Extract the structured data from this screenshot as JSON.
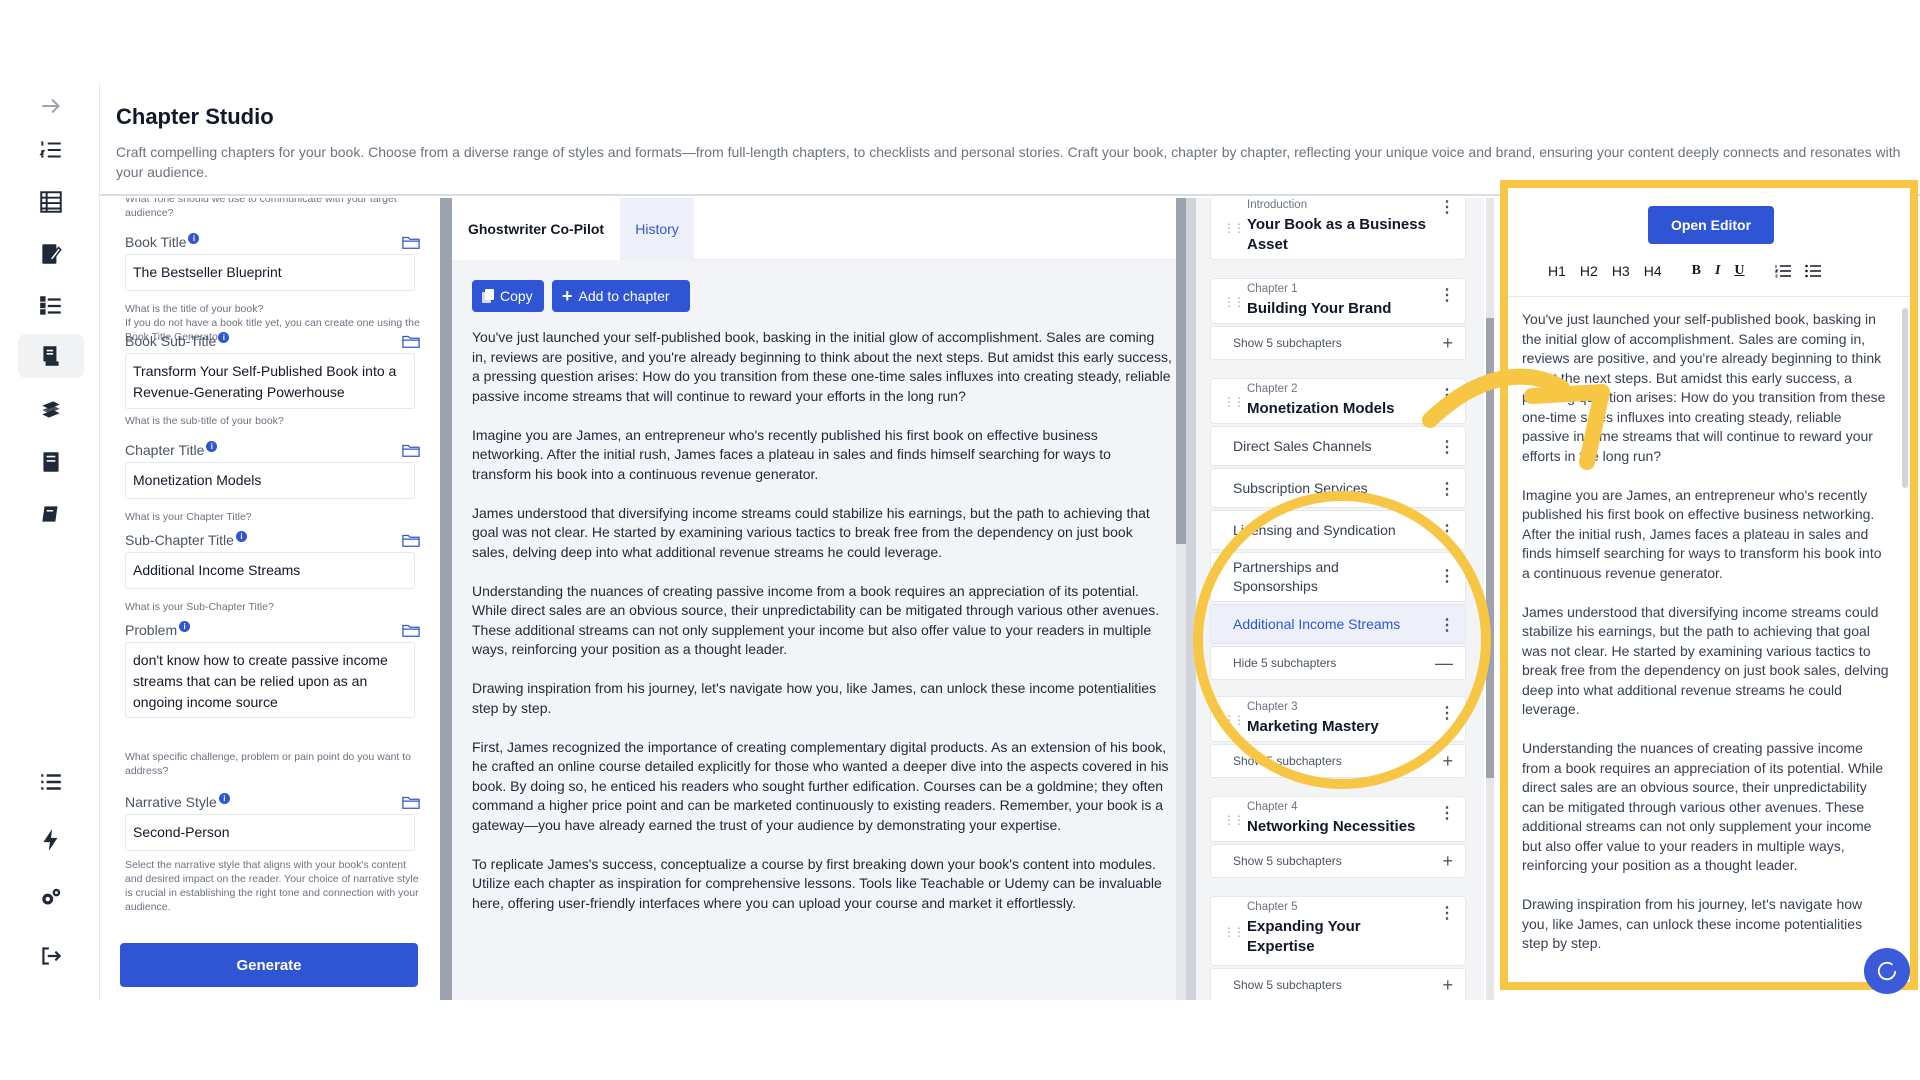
{
  "header": {
    "title": "Chapter Studio",
    "description": "Craft compelling chapters for your book. Choose from a diverse range of styles and formats—from full-length chapters, to checklists and personal stories. Craft your book, chapter by chapter, reflecting your unique voice and brand, ensuring your content deeply connects and resonates with your audience."
  },
  "form": {
    "tone_help_cut": "What Tone should we use to communicate with your target audience?",
    "fields": [
      {
        "label": "Book Title",
        "value": "The Bestseller Blueprint",
        "help": "What is the title of your book?\nIf you do not have a book title yet, you can create one using the Book Title Generator."
      },
      {
        "label": "Book Sub-Title",
        "value": "Transform Your Self-Published Book into a Revenue-Generating Powerhouse",
        "help": "What is the sub-title of your book?"
      },
      {
        "label": "Chapter Title",
        "value": "Monetization Models",
        "help": "What is your Chapter Title?"
      },
      {
        "label": "Sub-Chapter Title",
        "value": "Additional Income Streams",
        "help": "What is your Sub-Chapter Title?"
      },
      {
        "label": "Problem",
        "value": "don't know how to create passive income streams that can be relied upon as an ongoing income source",
        "help": "What specific challenge, problem or pain point do you want to address?"
      },
      {
        "label": "Narrative Style",
        "value": "Second-Person",
        "help": "Select the narrative style that aligns with your book's content and desired impact on the reader. Your choice of narrative style is crucial in establishing the right tone and connection with your audience."
      }
    ],
    "generate_label": "Generate"
  },
  "copilot": {
    "tab_ghost": "Ghostwriter Co-Pilot",
    "tab_history": "History",
    "copy_label": "Copy",
    "add_label": "Add to chapter",
    "paragraphs": [
      "You've just launched your self-published book, basking in the initial glow of accomplishment. Sales are coming in, reviews are positive, and you're already beginning to think about the next steps. But amidst this early success, a pressing question arises: How do you transition from these one-time sales influxes into creating steady, reliable passive income streams that will continue to reward your efforts in the long run?",
      "Imagine you are James, an entrepreneur who's recently published his first book on effective business networking. After the initial rush, James faces a plateau in sales and finds himself searching for ways to transform his book into a continuous revenue generator.",
      "James understood that diversifying income streams could stabilize his earnings, but the path to achieving that goal was not clear. He started by examining various tactics to break free from the dependency on just book sales, delving deep into what additional revenue streams he could leverage.",
      "Understanding the nuances of creating passive income from a book requires an appreciation of its potential. While direct sales are an obvious source, their unpredictability can be mitigated through various other avenues. These additional streams can not only supplement your income but also offer value to your readers in multiple ways, reinforcing your position as a thought leader.",
      "Drawing inspiration from his journey, let's navigate how you, like James, can unlock these income potentialities step by step.",
      "First, James recognized the importance of creating complementary digital products. As an extension of his book, he crafted an online course detailed explicitly for those who wanted a deeper dive into the aspects covered in his book. By doing so, he enticed his readers who sought further edification. Courses can be a goldmine; they often command a higher price point and can be marketed continuously to existing readers. Remember, your book is a gateway—you have already earned the trust of your audience by demonstrating your expertise.",
      "To replicate James's success, conceptualize a course by first breaking down your book's content into modules. Utilize each chapter as inspiration for comprehensive lessons. Tools like Teachable or Udemy can be invaluable here, offering user-friendly interfaces where you can upload your course and market it effortlessly."
    ]
  },
  "outline": {
    "intro": {
      "kicker": "Introduction",
      "title": "Your Book as a Business Asset"
    },
    "ch1": {
      "kicker": "Chapter 1",
      "title": "Building Your Brand",
      "toggle": "Show 5 subchapters"
    },
    "ch2": {
      "kicker": "Chapter 2",
      "title": "Monetization Models",
      "toggle": "Hide 5 subchapters",
      "subs": [
        "Direct Sales Channels",
        "Subscription Services",
        "Licensing and Syndication",
        "Partnerships and Sponsorships",
        "Additional Income Streams"
      ]
    },
    "ch3": {
      "kicker": "Chapter 3",
      "title": "Marketing Mastery",
      "toggle": "Show 5 subchapters"
    },
    "ch4": {
      "kicker": "Chapter 4",
      "title": "Networking Necessities",
      "toggle": "Show 5 subchapters"
    },
    "ch5": {
      "kicker": "Chapter 5",
      "title": "Expanding Your Expertise",
      "toggle": "Show 5 subchapters"
    }
  },
  "editor": {
    "open_label": "Open Editor",
    "toolbar": [
      "H1",
      "H2",
      "H3",
      "H4",
      "B",
      "I",
      "U"
    ],
    "paragraphs": [
      "You've just launched your self-published book, basking in the initial glow of accomplishment. Sales are coming in, reviews are positive, and you're already beginning to think about the next steps. But amidst this early success, a pressing question arises: How do you transition from these one-time sales influxes into creating steady, reliable passive income streams that will continue to reward your efforts in the long run?",
      "Imagine you are James, an entrepreneur who's recently published his first book on effective business networking. After the initial rush, James faces a plateau in sales and finds himself searching for ways to transform his book into a continuous revenue generator.",
      "James understood that diversifying income streams could stabilize his earnings, but the path to achieving that goal was not clear. He started by examining various tactics to break free from the dependency on just book sales, delving deep into what additional revenue streams he could leverage.",
      "Understanding the nuances of creating passive income from a book requires an appreciation of its potential. While direct sales are an obvious source, their unpredictability can be mitigated through various other avenues. These additional streams can not only supplement your income but also offer value to your readers in multiple ways, reinforcing your position as a thought leader.",
      "Drawing inspiration from his journey, let's navigate how you, like James, can unlock these income potentialities step by step."
    ]
  },
  "colors": {
    "accent": "#2f55d4",
    "annotation": "#f6c644"
  }
}
